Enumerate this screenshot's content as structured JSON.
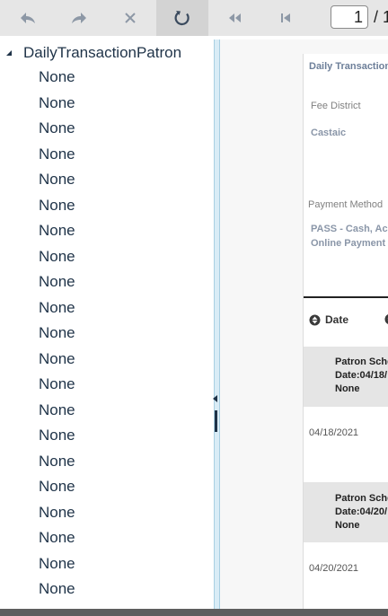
{
  "toolbar": {
    "buttons": [
      {
        "name": "back-icon"
      },
      {
        "name": "forward-icon"
      },
      {
        "name": "stop-icon"
      },
      {
        "name": "refresh-icon"
      },
      {
        "name": "first-page-icon"
      },
      {
        "name": "previous-page-icon"
      }
    ],
    "page_current": "1",
    "page_total_partial": "/ 1"
  },
  "tree": {
    "root_label": "DailyTransactionPatron",
    "items": [
      "None",
      "None",
      "None",
      "None",
      "None",
      "None",
      "None",
      "None",
      "None",
      "None",
      "None",
      "None",
      "None",
      "None",
      "None",
      "None",
      "None",
      "None",
      "None",
      "None",
      "None"
    ]
  },
  "report": {
    "title": "Daily Transaction",
    "fee_district_label": "Fee District",
    "fee_district_value": "Castaic",
    "payment_method_label": "Payment Method",
    "payment_method_value_line1": "PASS - Cash, Acc",
    "payment_method_value_line2": "Online Payment",
    "column_date": "Date",
    "groups": [
      {
        "text": "Patron Sche\nDate:04/18/\nNone",
        "date": "04/18/2021"
      },
      {
        "text": "Patron Sche\nDate:04/20/\nNone",
        "date": "04/20/2021"
      }
    ]
  },
  "colors": {
    "toolbar_bg": "#e6e6e6",
    "tree_text": "#1f3348",
    "splitter": "#d9ecf6",
    "group_bg": "#e5e5e5"
  }
}
